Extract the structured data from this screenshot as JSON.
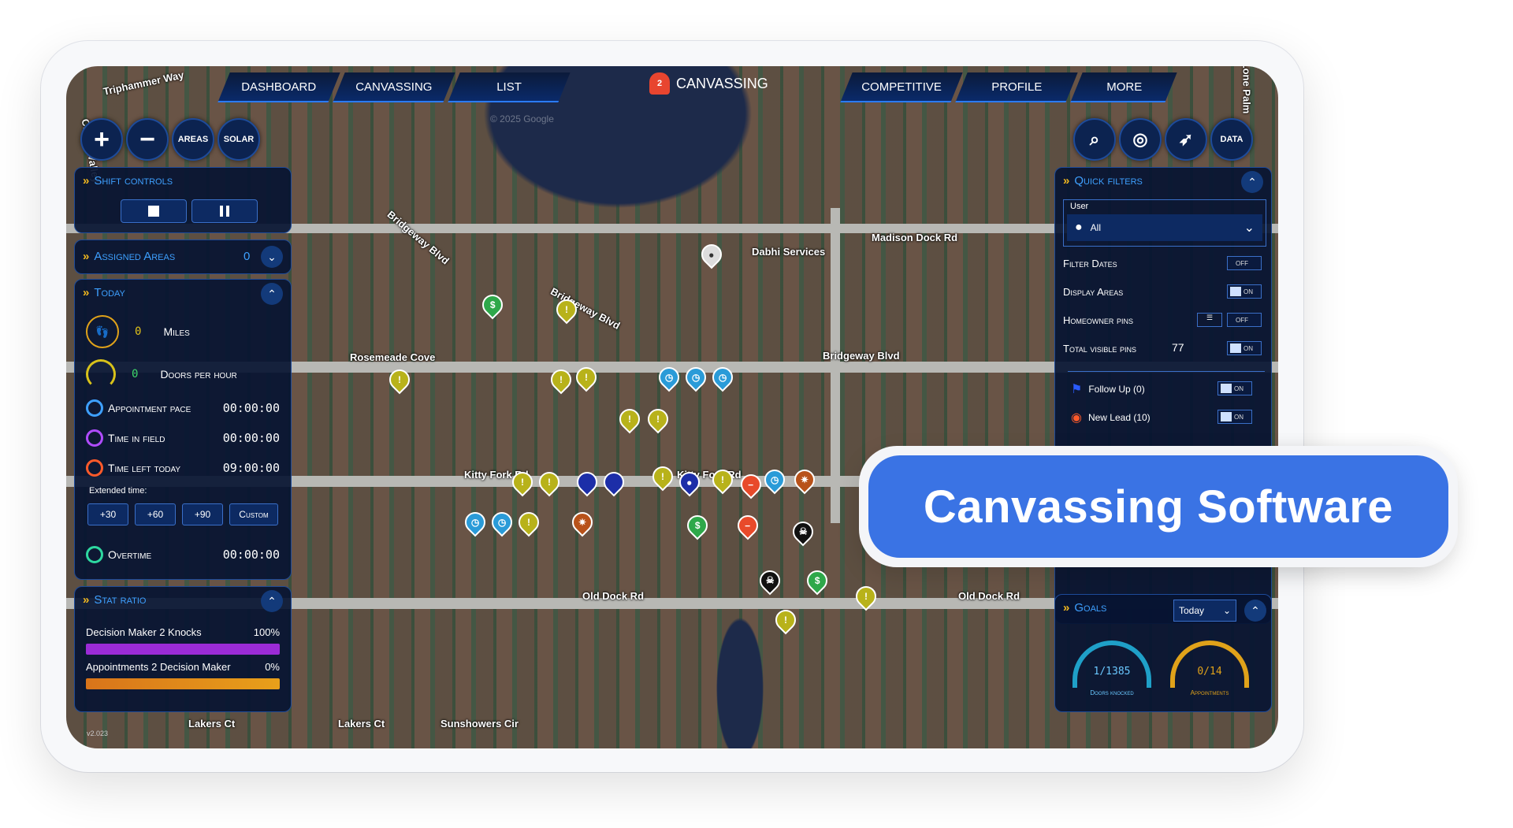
{
  "nav": {
    "tabs_left": [
      "DASHBOARD",
      "CANVASSING",
      "LIST"
    ],
    "brand_label": "CANVASSING",
    "alert_count": "2",
    "tabs_right": [
      "COMPETITIVE",
      "PROFILE",
      "MORE"
    ],
    "watermark": "© 2025 Google"
  },
  "map_controls": {
    "zoom_in": "+",
    "zoom_out": "−",
    "areas": "AREAS",
    "solar": "SOLAR",
    "data": "DATA"
  },
  "shift_controls": {
    "title": "Shift controls"
  },
  "assigned_areas": {
    "title": "Assigned Areas",
    "count": "0"
  },
  "today": {
    "title": "Today",
    "miles_value": "0",
    "miles_label": "Miles",
    "doors_value": "0",
    "doors_label": "Doors per hour",
    "rows": [
      {
        "label": "Appointment pace",
        "value": "00:00:00",
        "color": "#3ea0ff"
      },
      {
        "label": "Time in field",
        "value": "00:00:00",
        "color": "#b04cff"
      },
      {
        "label": "Time left today",
        "value": "09:00:00",
        "color": "#ff5a2a"
      }
    ],
    "extended_label": "Extended time:",
    "extended_buttons": [
      "+30",
      "+60",
      "+90",
      "Custom"
    ],
    "overtime_label": "Overtime",
    "overtime_value": "00:00:00"
  },
  "stat_ratio": {
    "title": "Stat ratio",
    "items": [
      {
        "label": "Decision Maker 2 Knocks",
        "value": "100%",
        "color": "#9b2bd6",
        "fill": 1.0
      },
      {
        "label": "Appointments 2 Decision Maker",
        "value": "0%",
        "color": "#e0891a",
        "fill": 1.0
      }
    ]
  },
  "version": "v2.023",
  "quick_filters": {
    "title": "Quick filters",
    "user_label": "User",
    "user_value": "All",
    "rows": [
      {
        "label": "Filter Dates",
        "state": "OFF"
      },
      {
        "label": "Display Areas",
        "state": "ON"
      },
      {
        "label": "Homeowner pins",
        "state": "OFF"
      },
      {
        "label": "Total visible pins",
        "count": "77",
        "state": "ON"
      }
    ],
    "pin_types": [
      {
        "label": "Follow Up (0)",
        "state": "ON",
        "color": "#2a5bff"
      },
      {
        "label": "New Lead (10)",
        "state": "ON",
        "color": "#ff5a2a"
      }
    ]
  },
  "goals": {
    "title": "Goals",
    "period": "Today",
    "gauges": [
      {
        "value": "1/1385",
        "label": "Doors knocked",
        "color": "#1fa0c8"
      },
      {
        "value": "0/14",
        "label": "Appointments",
        "color": "#e0a21a"
      }
    ]
  },
  "streets": [
    "Triphammer Way",
    "Cherry Valley",
    "Bridgeway Blvd",
    "Bridgeway Blvd",
    "Madison Dock Rd",
    "Dabhi Services",
    "Rosemeade Cove",
    "Bridgeway Blvd",
    "Kitty Fork Rd",
    "Kitty Fork Rd",
    "Old Dock Rd",
    "Old Dock Rd",
    "Lakers Ct",
    "Lakers Ct",
    "Sunshowers Cir",
    "Lone Palm"
  ],
  "cta": {
    "label": "Canvassing Software"
  }
}
